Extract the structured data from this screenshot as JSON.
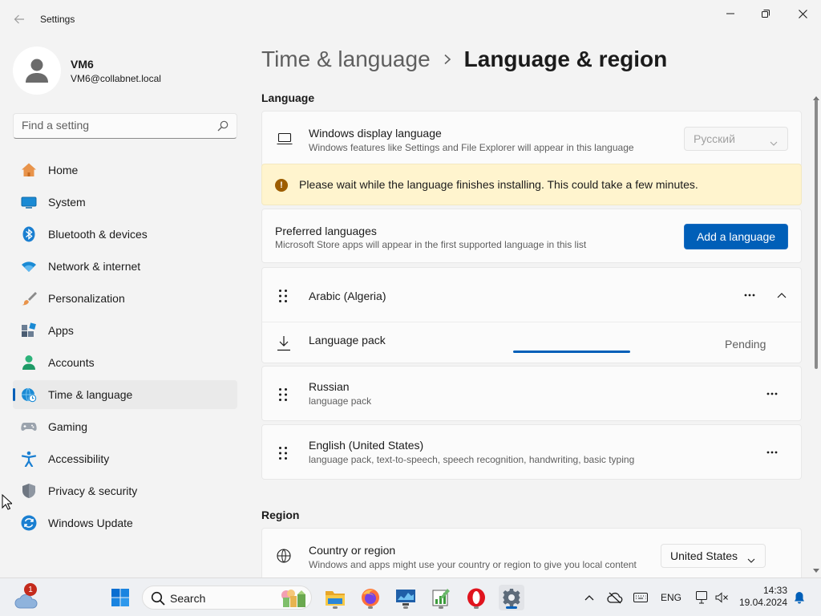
{
  "window": {
    "title": "Settings"
  },
  "user": {
    "name": "VM6",
    "email": "VM6@collabnet.local"
  },
  "search": {
    "placeholder": "Find a setting"
  },
  "nav": [
    {
      "id": "home",
      "label": "Home",
      "icon": "home-icon"
    },
    {
      "id": "system",
      "label": "System",
      "icon": "system-icon"
    },
    {
      "id": "bluetooth",
      "label": "Bluetooth & devices",
      "icon": "bluetooth-icon"
    },
    {
      "id": "network",
      "label": "Network & internet",
      "icon": "wifi-icon"
    },
    {
      "id": "personalization",
      "label": "Personalization",
      "icon": "brush-icon"
    },
    {
      "id": "apps",
      "label": "Apps",
      "icon": "apps-icon"
    },
    {
      "id": "accounts",
      "label": "Accounts",
      "icon": "accounts-icon"
    },
    {
      "id": "time-language",
      "label": "Time & language",
      "icon": "globe-clock-icon",
      "selected": true
    },
    {
      "id": "gaming",
      "label": "Gaming",
      "icon": "gamepad-icon"
    },
    {
      "id": "accessibility",
      "label": "Accessibility",
      "icon": "accessibility-icon"
    },
    {
      "id": "privacy",
      "label": "Privacy & security",
      "icon": "shield-icon"
    },
    {
      "id": "update",
      "label": "Windows Update",
      "icon": "update-icon"
    }
  ],
  "breadcrumb": {
    "parent": "Time & language",
    "current": "Language & region"
  },
  "language_section": {
    "title": "Language",
    "display_language": {
      "title": "Windows display language",
      "subtitle": "Windows features like Settings and File Explorer will appear in this language",
      "value": "Русский"
    },
    "warning": "Please wait while the language finishes installing. This could take a few minutes.",
    "preferred": {
      "title": "Preferred languages",
      "subtitle": "Microsoft Store apps will appear in the first supported language in this list",
      "button": "Add a language"
    },
    "languages": [
      {
        "name": "Arabic (Algeria)",
        "features": "",
        "expanded": true,
        "pack": {
          "label": "Language pack",
          "status": "Pending"
        }
      },
      {
        "name": "Russian",
        "features": "language pack"
      },
      {
        "name": "English (United States)",
        "features": "language pack, text-to-speech, speech recognition, handwriting, basic typing"
      }
    ]
  },
  "region_section": {
    "title": "Region",
    "country": {
      "title": "Country or region",
      "subtitle": "Windows and apps might use your country or region to give you local content",
      "value": "United States"
    }
  },
  "taskbar": {
    "weather_badge": "1",
    "search_label": "Search",
    "language": "ENG",
    "time": "14:33",
    "date": "19.04.2024"
  },
  "colors": {
    "accent": "#005fb8",
    "warning_bg": "#fff4ce",
    "warning_icon": "#9d5d00"
  }
}
